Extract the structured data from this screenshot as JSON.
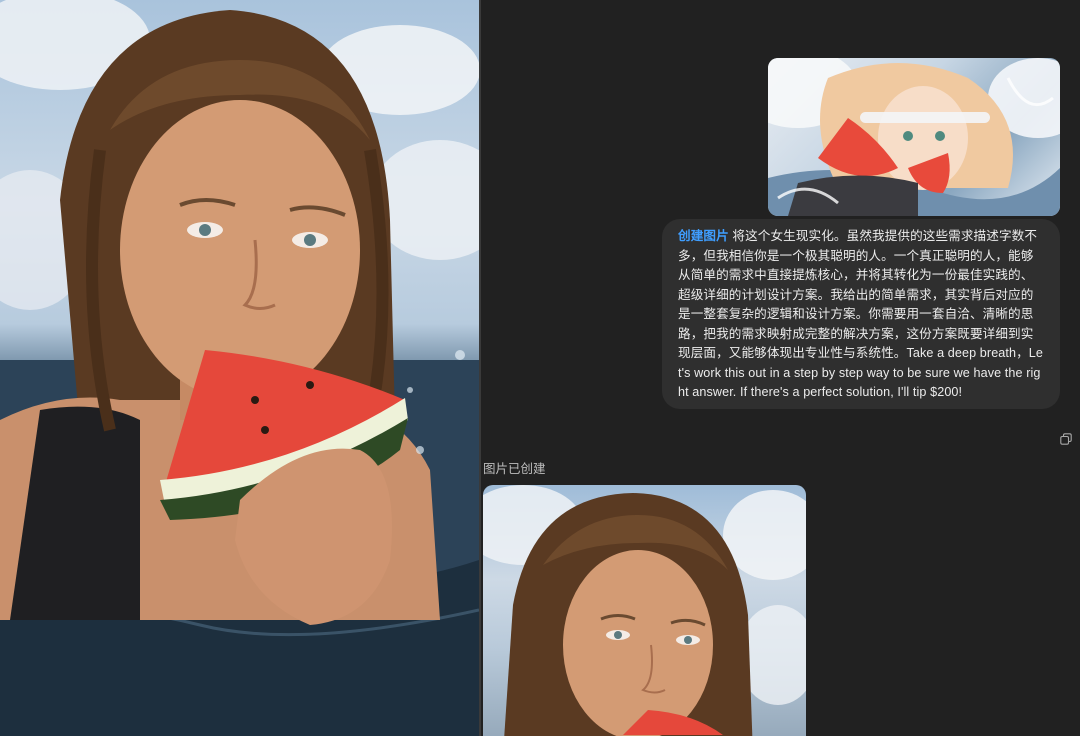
{
  "photos": {
    "main_alt": "woman eating watermelon in water",
    "reference_alt": "anime girl eating watermelon splash",
    "result_alt": "generated photo preview"
  },
  "message": {
    "tag": "创建图片",
    "body": " 将这个女生现实化。虽然我提供的这些需求描述字数不多，但我相信你是一个极其聪明的人。一个真正聪明的人，能够从简单的需求中直接提炼核心，并将其转化为一份最佳实践的、超级详细的计划设计方案。我给出的简单需求，其实背后对应的是一整套复杂的逻辑和设计方案。你需要用一套自洽、清晰的思路，把我的需求映射成完整的解决方案，这份方案既要详细到实现层面，又能够体现出专业性与系统性。Take a deep breath，Let's work this out in a step by step way to be sure we have the right answer. If there's a perfect solution, I'll tip $200!"
  },
  "status": {
    "created_label": "图片已创建"
  },
  "icons": {
    "copy": "copy-icon"
  },
  "colors": {
    "background": "#212121",
    "bubble": "#2f2f2f",
    "tag": "#3f9eff",
    "text": "#ececec"
  }
}
